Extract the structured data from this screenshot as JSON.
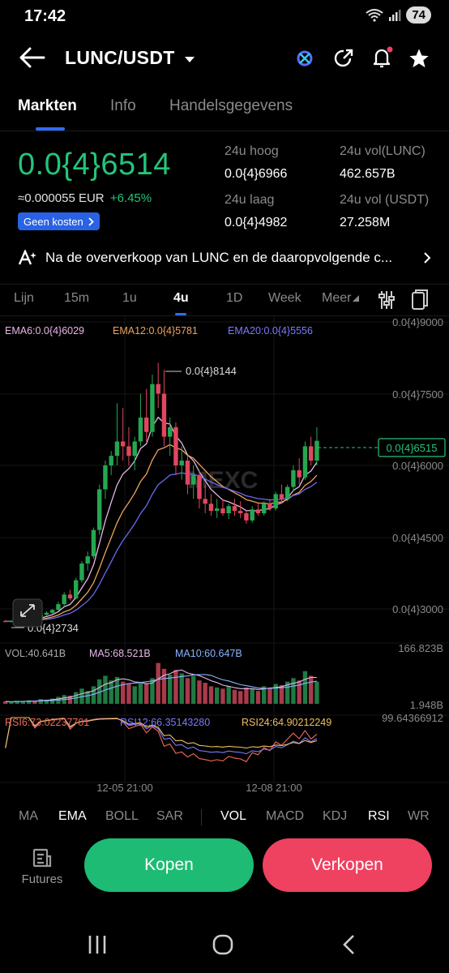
{
  "status_bar": {
    "time": "17:42",
    "battery": "74"
  },
  "header": {
    "pair": "LUNC/USDT"
  },
  "tabs": [
    "Markten",
    "Info",
    "Handelsgegevens"
  ],
  "ticker": {
    "last_price": "0.0{4}6514",
    "eur_price": "≈0.000055 EUR",
    "change": "+6.45%",
    "badge": "Geen kosten",
    "high_label": "24u hoog",
    "high_value": "0.0{4}6966",
    "low_label": "24u laag",
    "low_value": "0.0{4}4982",
    "vol_lunc_label": "24u vol(LUNC)",
    "vol_lunc_value": "462.657B",
    "vol_usdt_label": "24u vol (USDT)",
    "vol_usdt_value": "27.258M"
  },
  "news": {
    "text": "Na de oververkoop van LUNC en de daaropvolgende c..."
  },
  "timeframes": [
    "Lijn",
    "15m",
    "1u",
    "4u",
    "1D",
    "Week",
    "Meer"
  ],
  "active_timeframe": "4u",
  "chart": {
    "ema_legend": [
      "EMA6:0.0{4}6029",
      "EMA12:0.0{4}5781",
      "EMA20:0.0{4}5556"
    ],
    "y_ticks": [
      "0.0{4}9000",
      "0.0{4}7500",
      "0.0{4}6000",
      "0.0{4}4500",
      "0.0{4}3000"
    ],
    "current_price_tag": "0.0{4}6515",
    "max_annotation": "0.0{4}8144",
    "min_annotation": "0.0{4}2734",
    "watermark": "MEXC",
    "vol_legend": [
      "VOL:40.641B",
      "MA5:68.521B",
      "MA10:60.647B"
    ],
    "vol_max": "166.823B",
    "vol_min": "1.948B",
    "rsi_legend": [
      "RSI6:73.02237701",
      "RSI12:66.35143280",
      "RSI24:64.90212249"
    ],
    "rsi_max": "99.64366912",
    "x_ticks": [
      "12-05 21:00",
      "12-08 21:00"
    ],
    "colors": {
      "up": "#25a750",
      "down": "#e0475f",
      "ema6": "#e6b8e6",
      "ema12": "#f0a35a",
      "ema20": "#6a6af0"
    }
  },
  "indicators": [
    "MA",
    "EMA",
    "BOLL",
    "SAR",
    "VOL",
    "MACD",
    "KDJ",
    "RSI",
    "WR"
  ],
  "actions": {
    "futures": "Futures",
    "buy": "Kopen",
    "sell": "Verkopen"
  }
}
